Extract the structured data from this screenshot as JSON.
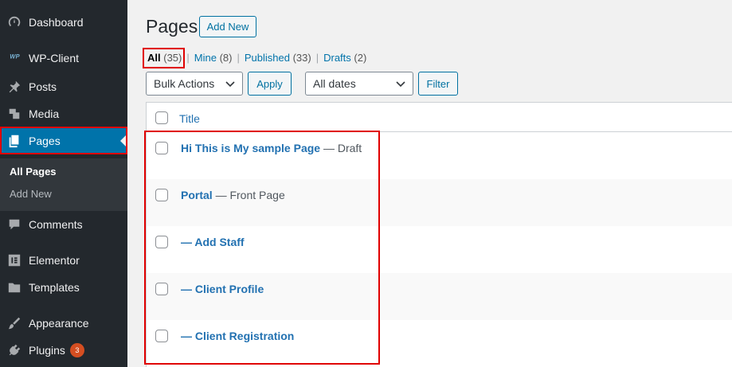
{
  "sidebar": {
    "items": [
      {
        "label": "Dashboard",
        "icon": "dashboard-icon"
      },
      {
        "label": "WP-Client",
        "icon": "wp-client-icon"
      },
      {
        "label": "Posts",
        "icon": "pin-icon"
      },
      {
        "label": "Media",
        "icon": "media-icon"
      },
      {
        "label": "Pages",
        "icon": "pages-icon"
      },
      {
        "label": "Comments",
        "icon": "comment-icon"
      },
      {
        "label": "Elementor",
        "icon": "elementor-icon"
      },
      {
        "label": "Templates",
        "icon": "folder-icon"
      },
      {
        "label": "Appearance",
        "icon": "brush-icon"
      },
      {
        "label": "Plugins",
        "icon": "plugin-icon",
        "badge": "3"
      }
    ],
    "submenu": [
      "All Pages",
      "Add New"
    ]
  },
  "header": {
    "title": "Pages",
    "add_new": "Add New"
  },
  "filters": {
    "all": {
      "label": "All",
      "count": "(35)"
    },
    "mine": {
      "label": "Mine",
      "count": "(8)"
    },
    "published": {
      "label": "Published",
      "count": "(33)"
    },
    "drafts": {
      "label": "Drafts",
      "count": "(2)"
    },
    "separator": "|"
  },
  "toolbar": {
    "bulk_actions": "Bulk Actions",
    "apply": "Apply",
    "all_dates": "All dates",
    "filter": "Filter"
  },
  "table": {
    "column_title": "Title",
    "rows": [
      {
        "title": "Hi This is My sample Page",
        "state": " — Draft"
      },
      {
        "title": "Portal",
        "state": " — Front Page"
      },
      {
        "title": "— Add Staff",
        "state": ""
      },
      {
        "title": "— Client Profile",
        "state": ""
      },
      {
        "title": "— Client Registration",
        "state": ""
      }
    ]
  },
  "colors": {
    "sidebar_bg": "#23282d",
    "active_bg": "#0073aa",
    "link": "#2271b1",
    "highlight": "#e00000",
    "badge": "#d54e21"
  }
}
